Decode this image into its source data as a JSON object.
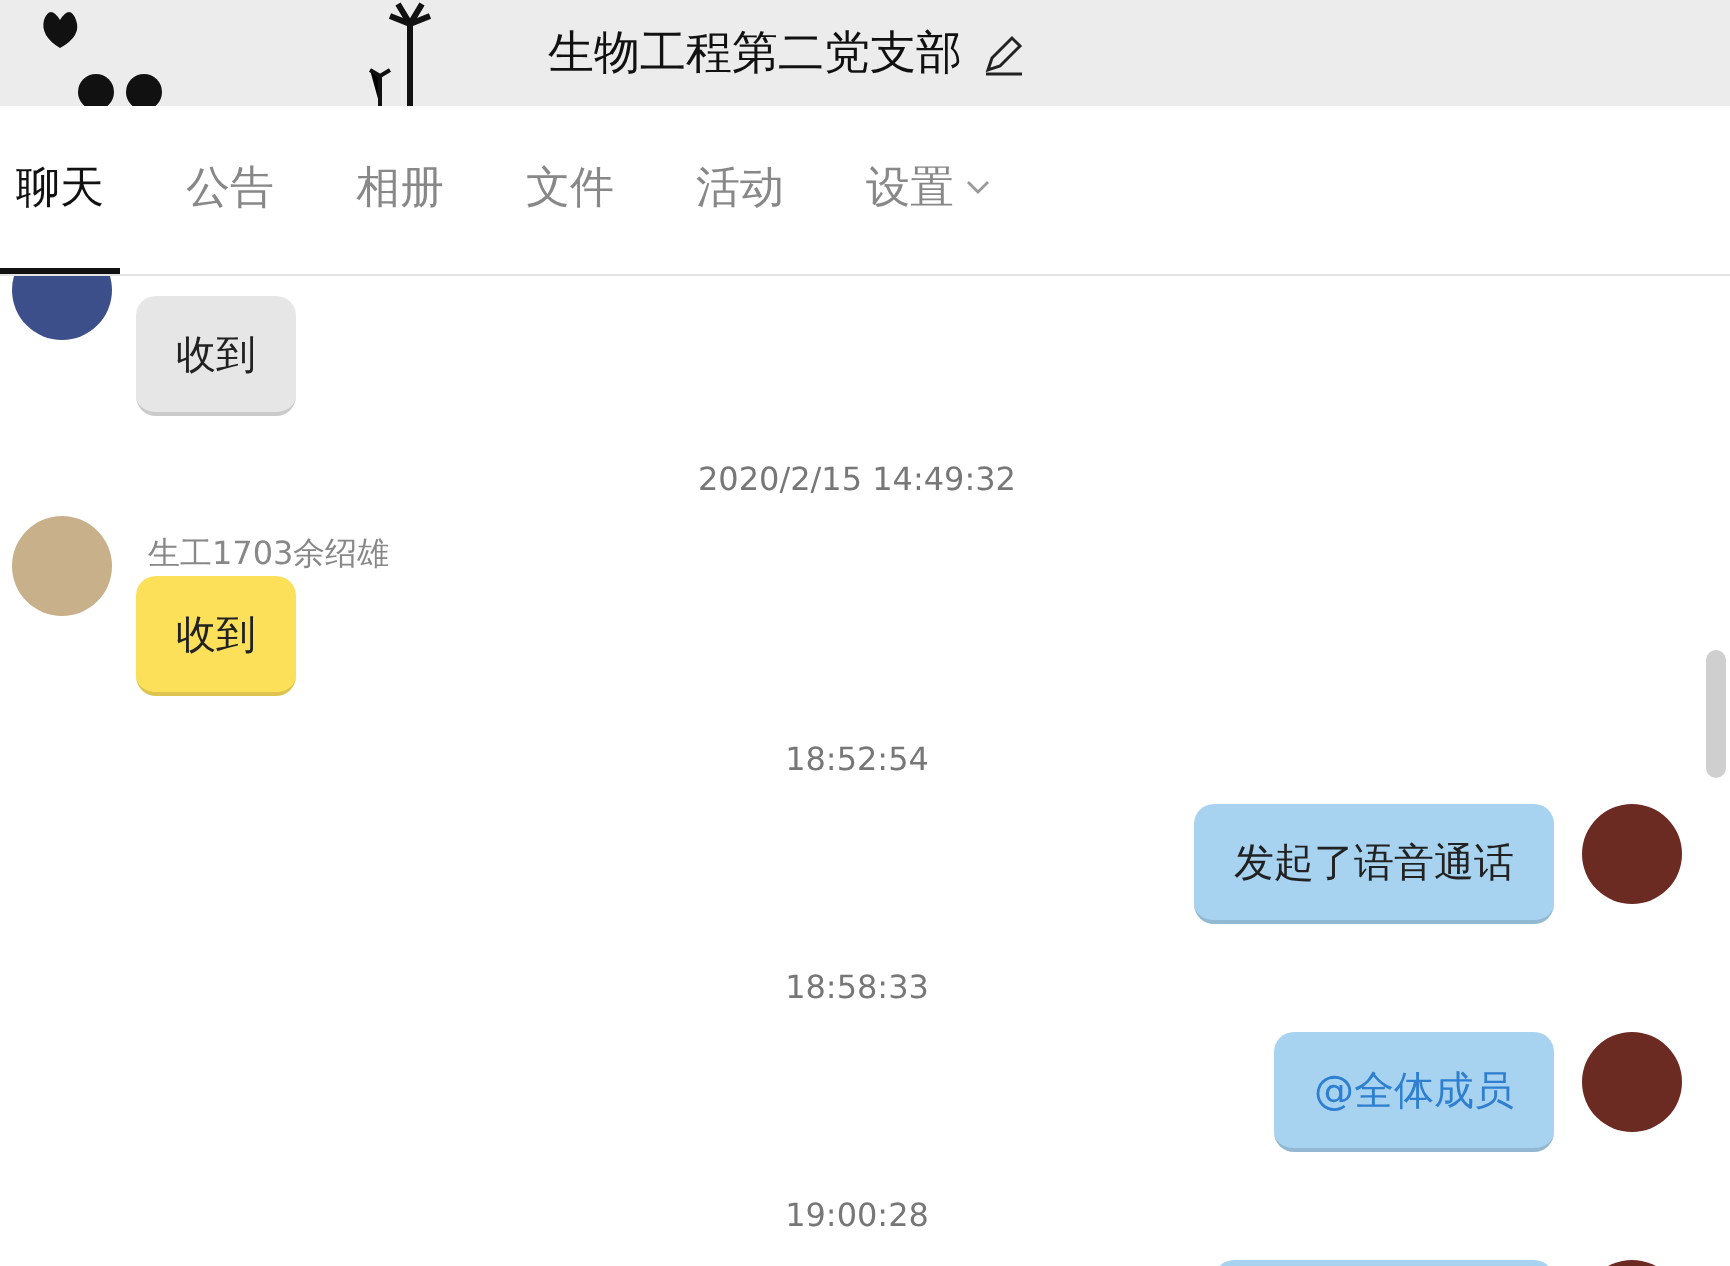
{
  "header": {
    "title": "生物工程第二党支部"
  },
  "tabs": [
    {
      "label": "聊天",
      "selected": true,
      "dropdown": false
    },
    {
      "label": "公告",
      "selected": false,
      "dropdown": false
    },
    {
      "label": "相册",
      "selected": false,
      "dropdown": false
    },
    {
      "label": "文件",
      "selected": false,
      "dropdown": false
    },
    {
      "label": "活动",
      "selected": false,
      "dropdown": false
    },
    {
      "label": "设置",
      "selected": false,
      "dropdown": true
    }
  ],
  "messages": [
    {
      "kind": "incoming",
      "color": "#e6e6e6",
      "text": "收到"
    },
    {
      "kind": "time",
      "text": "2020/2/15 14:49:32"
    },
    {
      "kind": "incoming",
      "color": "#fde05a",
      "sender": "生工1703余绍雄",
      "text": "收到"
    },
    {
      "kind": "time",
      "text": "18:52:54"
    },
    {
      "kind": "outgoing",
      "color": "#a8d3f0",
      "text": "发起了语音通话",
      "mention": false
    },
    {
      "kind": "time",
      "text": "18:58:33"
    },
    {
      "kind": "outgoing",
      "color": "#a8d3f0",
      "text": "@全体成员",
      "mention": true
    },
    {
      "kind": "time",
      "text": "19:00:28"
    },
    {
      "kind": "partial",
      "color": "#a8d3f0"
    }
  ]
}
